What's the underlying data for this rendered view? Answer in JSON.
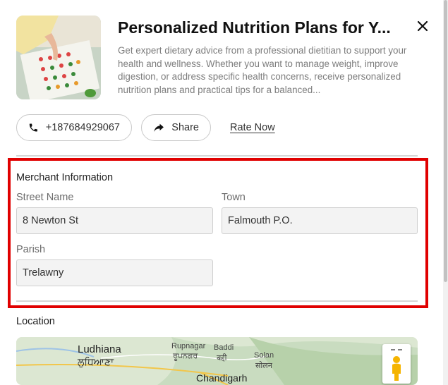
{
  "listing": {
    "title": "Personalized Nutrition Plans for Y...",
    "description": "Get expert dietary advice from a professional dietitian to support your health and wellness. Whether you want to manage weight, improve digestion, or address specific health concerns, receive personalized nutrition plans and practical tips for a balanced..."
  },
  "actions": {
    "phone_label": "+187684929067",
    "share_label": "Share",
    "rate_label": "Rate Now"
  },
  "merchant": {
    "section_title": "Merchant Information",
    "street_label": "Street Name",
    "street_value": "8 Newton St",
    "town_label": "Town",
    "town_value": "Falmouth P.O.",
    "parish_label": "Parish",
    "parish_value": "Trelawny"
  },
  "location": {
    "section_title": "Location",
    "map_labels": [
      "Ludhiana",
      "ਲੁਧਿਆਣਾ",
      "Rupnagar",
      "ਰੂਪਨਗਰ",
      "Baddi",
      "बद्दी",
      "Solan",
      "सोलन",
      "Chandigarh"
    ]
  },
  "colors": {
    "highlight": "#e00000",
    "map_land": "#d9e5cf"
  },
  "icons": [
    "phone-icon",
    "share-icon",
    "close-icon",
    "pegman-icon"
  ]
}
